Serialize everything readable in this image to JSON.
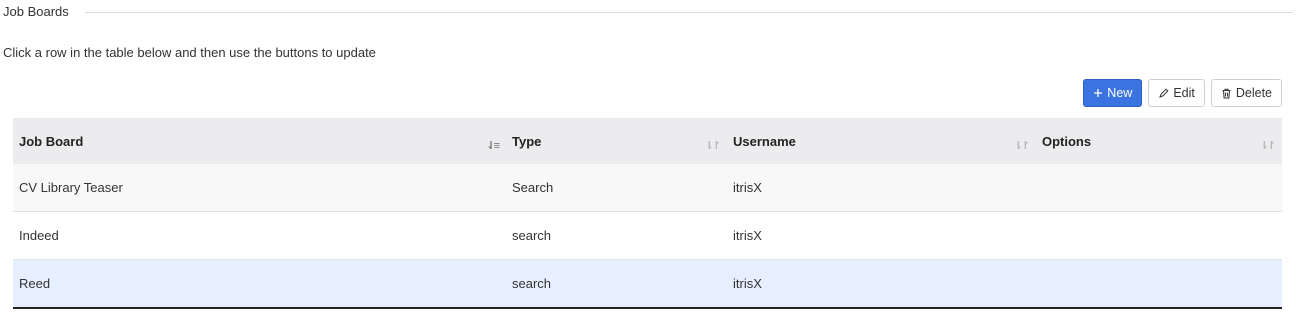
{
  "section": {
    "title": "Job Boards",
    "instructions": "Click a row in the table below and then use the buttons to update"
  },
  "toolbar": {
    "new_label": "New",
    "edit_label": "Edit",
    "delete_label": "Delete"
  },
  "table": {
    "columns": [
      "Job Board",
      "Type",
      "Username",
      "Options"
    ],
    "rows": [
      {
        "job_board": "CV Library Teaser",
        "type": "Search",
        "username": "itrisX",
        "options": ""
      },
      {
        "job_board": "Indeed",
        "type": "search",
        "username": "itrisX",
        "options": ""
      },
      {
        "job_board": "Reed",
        "type": "search",
        "username": "itrisX",
        "options": ""
      }
    ],
    "selected_row": 2,
    "sorted_column": "Job Board"
  },
  "colors": {
    "primary": "#3b73e0",
    "header_bg": "#ececef",
    "selected_bg": "#e6efff"
  }
}
